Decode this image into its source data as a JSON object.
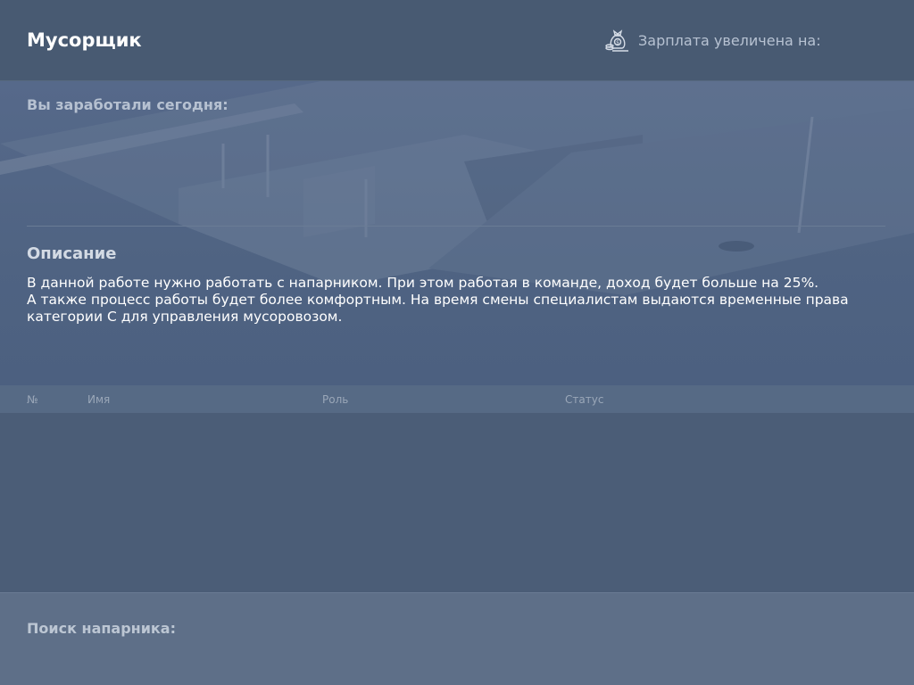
{
  "header": {
    "title": "Мусорщик",
    "salary_label": "Зарплата увеличена на:",
    "salary_icon": "money-bag-icon"
  },
  "earnings": {
    "label": "Вы заработали сегодня:"
  },
  "description": {
    "title": "Описание",
    "lines": [
      "В данной работе нужно работать с напарником. При этом работая в команде, доход будет больше на 25%.",
      "А также процесс работы будет более комфортным. На время смены специалистам выдаются временные права",
      "категории С для управления мусоровозом."
    ]
  },
  "team_table": {
    "columns": [
      "№",
      "Имя",
      "Роль",
      "Статус"
    ],
    "rows": []
  },
  "partner_search": {
    "label": "Поиск напарника:"
  },
  "colors": {
    "background": "#4a5d78",
    "header": "#485a72",
    "footer": "#5e6f88",
    "muted_text": "#b7c2d2"
  }
}
